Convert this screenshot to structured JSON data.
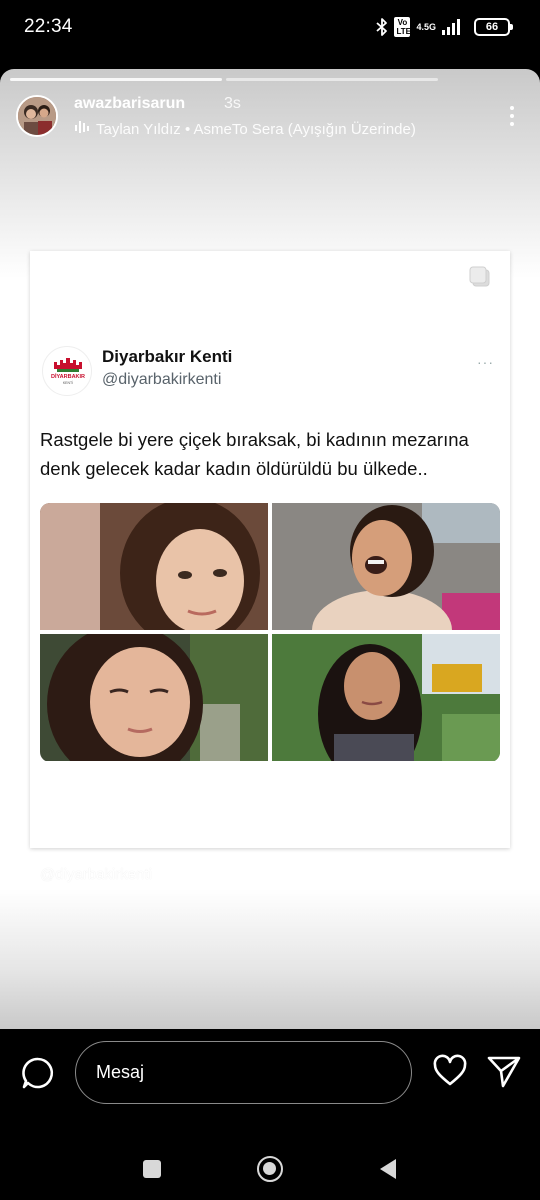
{
  "status_bar": {
    "time": "22:34",
    "network_badge": "Vo LTE",
    "network_type": "4.5G",
    "battery": "66",
    "icons": [
      "bluetooth-icon",
      "volte-icon",
      "signal-icon",
      "battery-icon"
    ]
  },
  "story": {
    "progress_segments": 2,
    "username": "awazbarisarun",
    "time_ago": "3s",
    "music": "Taylan Yıldız • AsmeTo Sera (Ayışığın Üzerinde)",
    "watermark": "@diyarbakirkenti"
  },
  "tweet": {
    "name": "Diyarbakır Kenti",
    "handle": "@diyarbakirkenti",
    "logo_text": "DİYARBAKIR",
    "logo_subtext": "KENTİ",
    "text": "Rastgele bi yere çiçek bıraksak, bi kadının mezarına denk gelecek kadar kadın öldürüldü bu ülkede..",
    "more": "···",
    "photo_count": 4
  },
  "message_bar": {
    "placeholder": "Mesaj"
  },
  "colors": {
    "background": "#000000",
    "story_gradient_edge": "#c9c9c9",
    "tweet_text": "#111111",
    "handle": "#59636b",
    "logo_red": "#c8102e"
  }
}
